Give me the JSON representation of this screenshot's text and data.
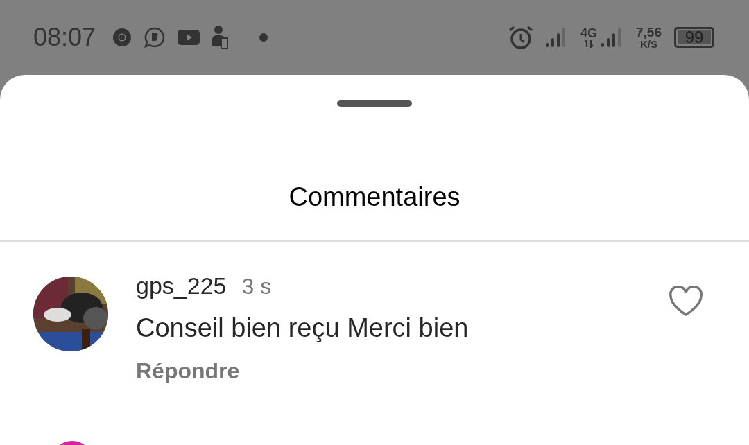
{
  "status_bar": {
    "time": "08:07",
    "network": "4G",
    "speed_value": "7,56",
    "speed_unit": "K/S",
    "battery": "99"
  },
  "sheet": {
    "title": "Commentaires"
  },
  "comments": [
    {
      "author": "gps_225",
      "age": "3 s",
      "text": "Conseil bien reçu Merci bien",
      "reply": "Répondre",
      "liked": false
    }
  ]
}
